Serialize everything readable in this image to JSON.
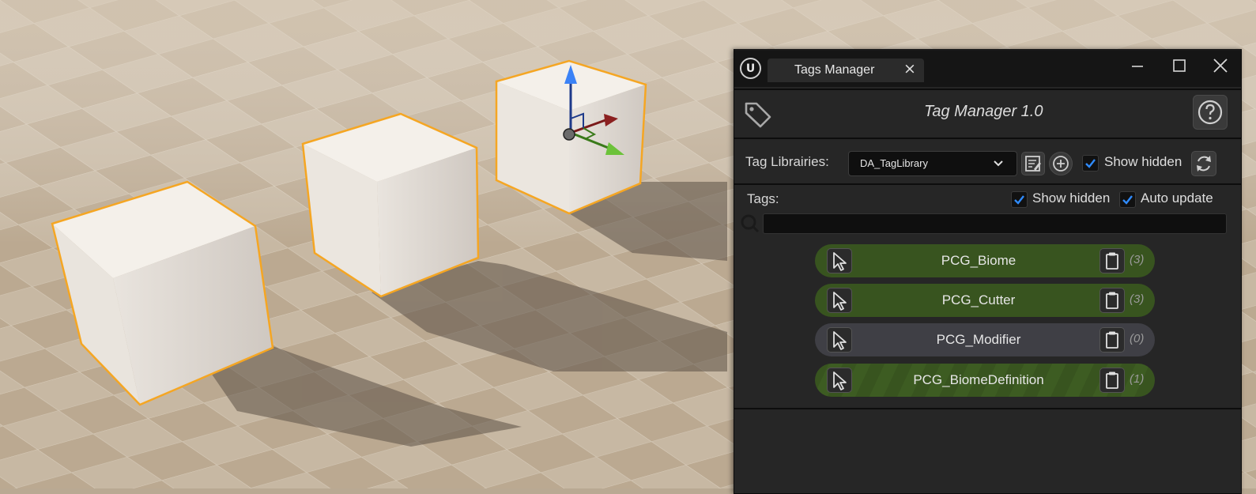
{
  "window": {
    "tab_title": "Tags Manager",
    "tab_close_glyph": "×",
    "logo_glyph": "U",
    "controls": [
      "minimize-icon",
      "maximize-icon",
      "close-icon"
    ]
  },
  "header": {
    "title": "Tag Manager 1.0",
    "left_icon": "tag-icon",
    "help_icon": "help-icon"
  },
  "library": {
    "label": "Tag Librairies:",
    "selected": "DA_TagLibrary",
    "show_hidden_label": "Show hidden",
    "show_hidden_checked": true
  },
  "tags": {
    "label": "Tags:",
    "show_hidden_label": "Show hidden",
    "show_hidden_checked": true,
    "auto_update_label": "Auto update",
    "auto_update_checked": true,
    "search_placeholder": "",
    "items": [
      {
        "name": "PCG_Biome",
        "count": "(3)",
        "state": "active"
      },
      {
        "name": "PCG_Cutter",
        "count": "(3)",
        "state": "active"
      },
      {
        "name": "PCG_Modifier",
        "count": "(0)",
        "state": "inactive"
      },
      {
        "name": "PCG_BiomeDefinition",
        "count": "(1)",
        "state": "striped"
      }
    ]
  },
  "colors": {
    "active_tag": "#38541f",
    "inactive_tag": "#3f3f45",
    "checkbox_accent": "#2f8bff",
    "selection_outline": "#f5a623"
  }
}
